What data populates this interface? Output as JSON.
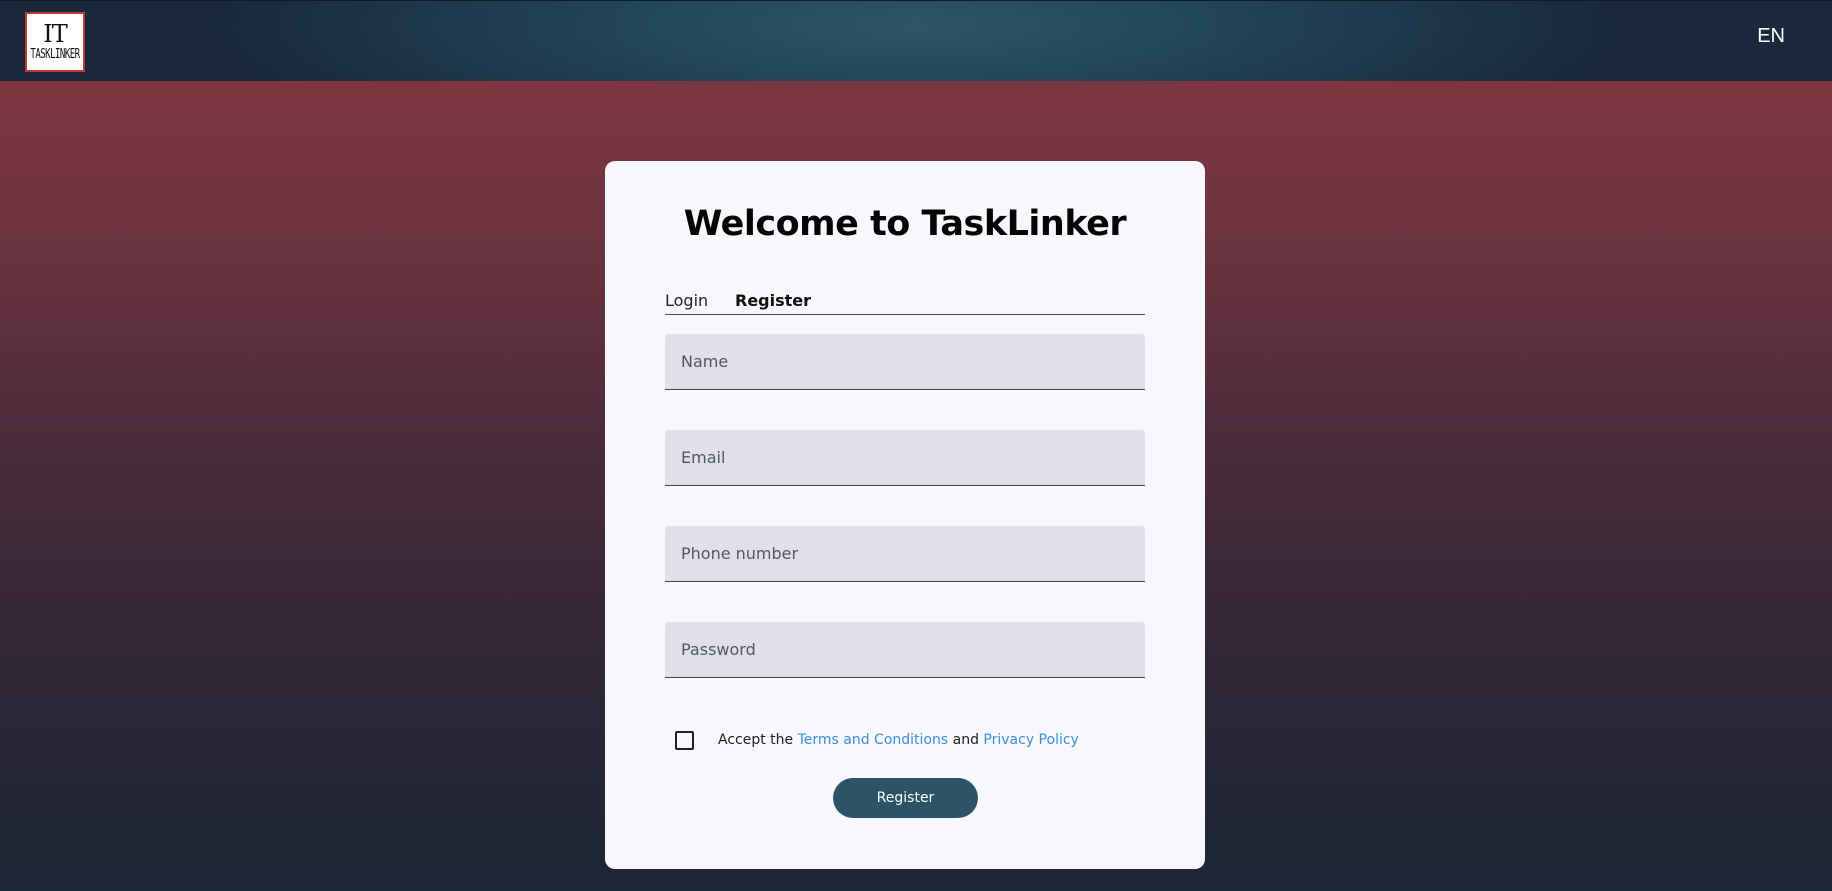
{
  "header": {
    "logo": {
      "mark": "IT",
      "word": "TASKLINKER"
    },
    "language": "EN"
  },
  "card": {
    "title": "Welcome to TaskLinker",
    "tabs": [
      {
        "label": "Login",
        "active": false
      },
      {
        "label": "Register",
        "active": true
      }
    ],
    "fields": {
      "name": {
        "placeholder": "Name",
        "value": ""
      },
      "email": {
        "placeholder": "Email",
        "value": ""
      },
      "phone": {
        "placeholder": "Phone number",
        "value": ""
      },
      "password": {
        "placeholder": "Password",
        "value": ""
      }
    },
    "consent": {
      "checked": false,
      "prefix": "Accept the",
      "terms_link": "Terms and Conditions",
      "conjunction": "and",
      "privacy_link": "Privacy Policy"
    },
    "submit_label": "Register"
  },
  "colors": {
    "accent": "#2b5567",
    "link": "#3b8fd6",
    "logo_border": "#c0392b"
  }
}
